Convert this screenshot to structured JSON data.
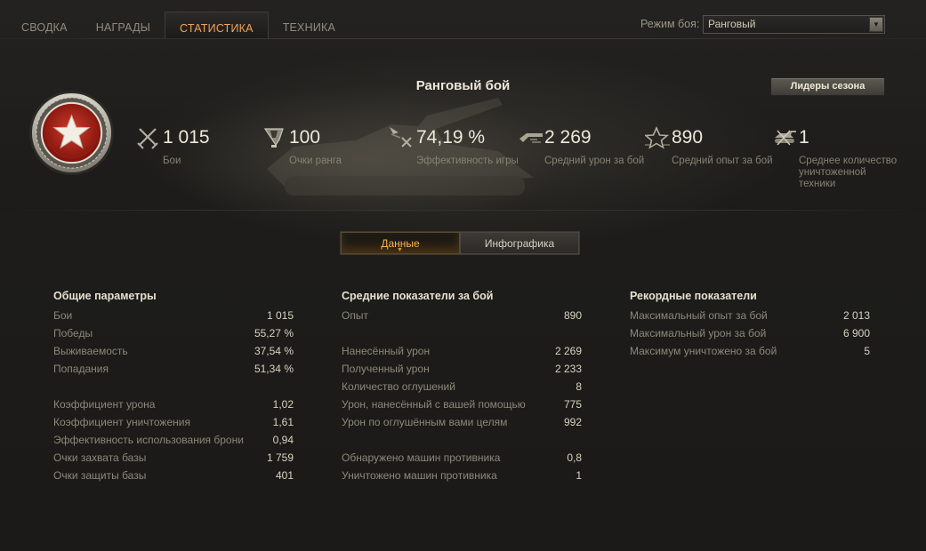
{
  "tabs": [
    {
      "label": "СВОДКА",
      "active": false
    },
    {
      "label": "НАГРАДЫ",
      "active": false
    },
    {
      "label": "СТАТИСТИКА",
      "active": true
    },
    {
      "label": "ТЕХНИКА",
      "active": false
    }
  ],
  "battle_mode": {
    "label": "Режим боя:",
    "value": "Ранговый"
  },
  "header": {
    "title": "Ранговый бой",
    "leaders_button": "Лидеры сезона",
    "stats": [
      {
        "icon": "crossed-swords-icon",
        "value": "1 015",
        "label": "Бои"
      },
      {
        "icon": "rank-cup-icon",
        "value": "100",
        "label": "Очки ранга"
      },
      {
        "icon": "efficiency-icon",
        "value": "74,19 %",
        "label": "Эффективность игры"
      },
      {
        "icon": "damage-icon",
        "value": "2 269",
        "label": "Средний урон за бой"
      },
      {
        "icon": "experience-star-icon",
        "value": "890",
        "label": "Средний опыт за бой"
      },
      {
        "icon": "destroyed-vehicle-icon",
        "value": "1",
        "label": "Среднее количество уничтоженной техники"
      }
    ]
  },
  "view_toggle": {
    "data_label": "Данные",
    "infographic_label": "Инфографика",
    "selected": "data"
  },
  "columns": [
    {
      "title": "Общие параметры",
      "groups": [
        [
          {
            "label": "Бои",
            "value": "1 015"
          },
          {
            "label": "Победы",
            "value": "55,27 %"
          },
          {
            "label": "Выживаемость",
            "value": "37,54 %"
          },
          {
            "label": "Попадания",
            "value": "51,34 %"
          }
        ],
        [
          {
            "label": "Коэффициент урона",
            "value": "1,02"
          },
          {
            "label": "Коэффициент уничтожения",
            "value": "1,61"
          },
          {
            "label": "Эффективность использования брони",
            "value": "0,94"
          },
          {
            "label": "Очки захвата базы",
            "value": "1 759"
          },
          {
            "label": "Очки защиты базы",
            "value": "401"
          }
        ]
      ]
    },
    {
      "title": "Средние показатели за бой",
      "groups": [
        [
          {
            "label": "Опыт",
            "value": "890"
          }
        ],
        [
          {
            "label": "Нанесённый урон",
            "value": "2 269"
          },
          {
            "label": "Полученный урон",
            "value": "2 233"
          },
          {
            "label": "Количество оглушений",
            "value": "8"
          },
          {
            "label": "Урон, нанесённый с вашей помощью",
            "value": "775"
          },
          {
            "label": "Урон по оглушённым вами целям",
            "value": "992"
          }
        ],
        [
          {
            "label": "Обнаружено машин противника",
            "value": "0,8"
          },
          {
            "label": "Уничтожено машин противника",
            "value": "1"
          }
        ]
      ]
    },
    {
      "title": "Рекордные показатели",
      "groups": [
        [
          {
            "label": "Максимальный опыт за бой",
            "value": "2 013"
          },
          {
            "label": "Максимальный урон за бой",
            "value": "6 900"
          },
          {
            "label": "Максимум уничтожено за бой",
            "value": "5"
          }
        ]
      ]
    }
  ]
}
